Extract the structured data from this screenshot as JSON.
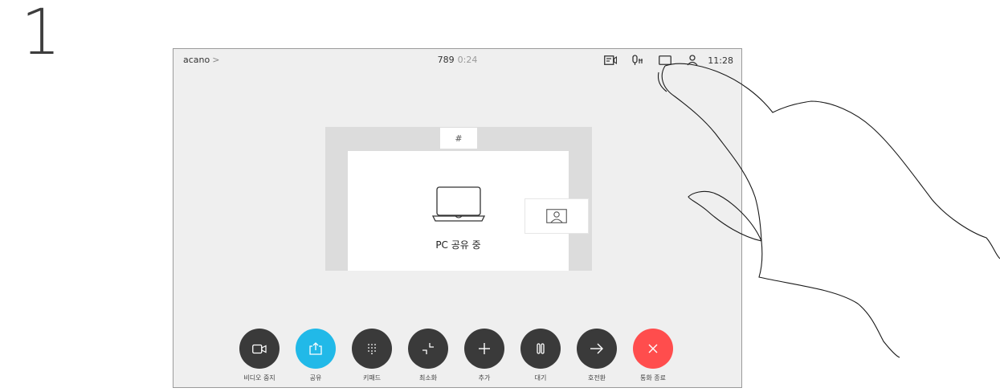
{
  "step": {
    "number": "1"
  },
  "topbar": {
    "title": "acano",
    "chevron": ">",
    "number": "789",
    "duration": "0:24",
    "clock": "11:28"
  },
  "share": {
    "hash_label": "#",
    "status_label": "PC 공유 중"
  },
  "controls": [
    {
      "label": "비디오 중지",
      "icon": "camera-icon"
    },
    {
      "label": "공유",
      "icon": "share-icon"
    },
    {
      "label": "키패드",
      "icon": "keypad-icon"
    },
    {
      "label": "최소화",
      "icon": "minimize-icon"
    },
    {
      "label": "추가",
      "icon": "plus-icon"
    },
    {
      "label": "대기",
      "icon": "hold-icon"
    },
    {
      "label": "호전환",
      "icon": "transfer-icon"
    },
    {
      "label": "통화 종료",
      "icon": "end-call-icon"
    }
  ],
  "colors": {
    "share_accent": "#21b9e8",
    "end_call": "#ff4d4d",
    "button_dark": "#3a3a3a",
    "screen_bg": "#efefef"
  }
}
